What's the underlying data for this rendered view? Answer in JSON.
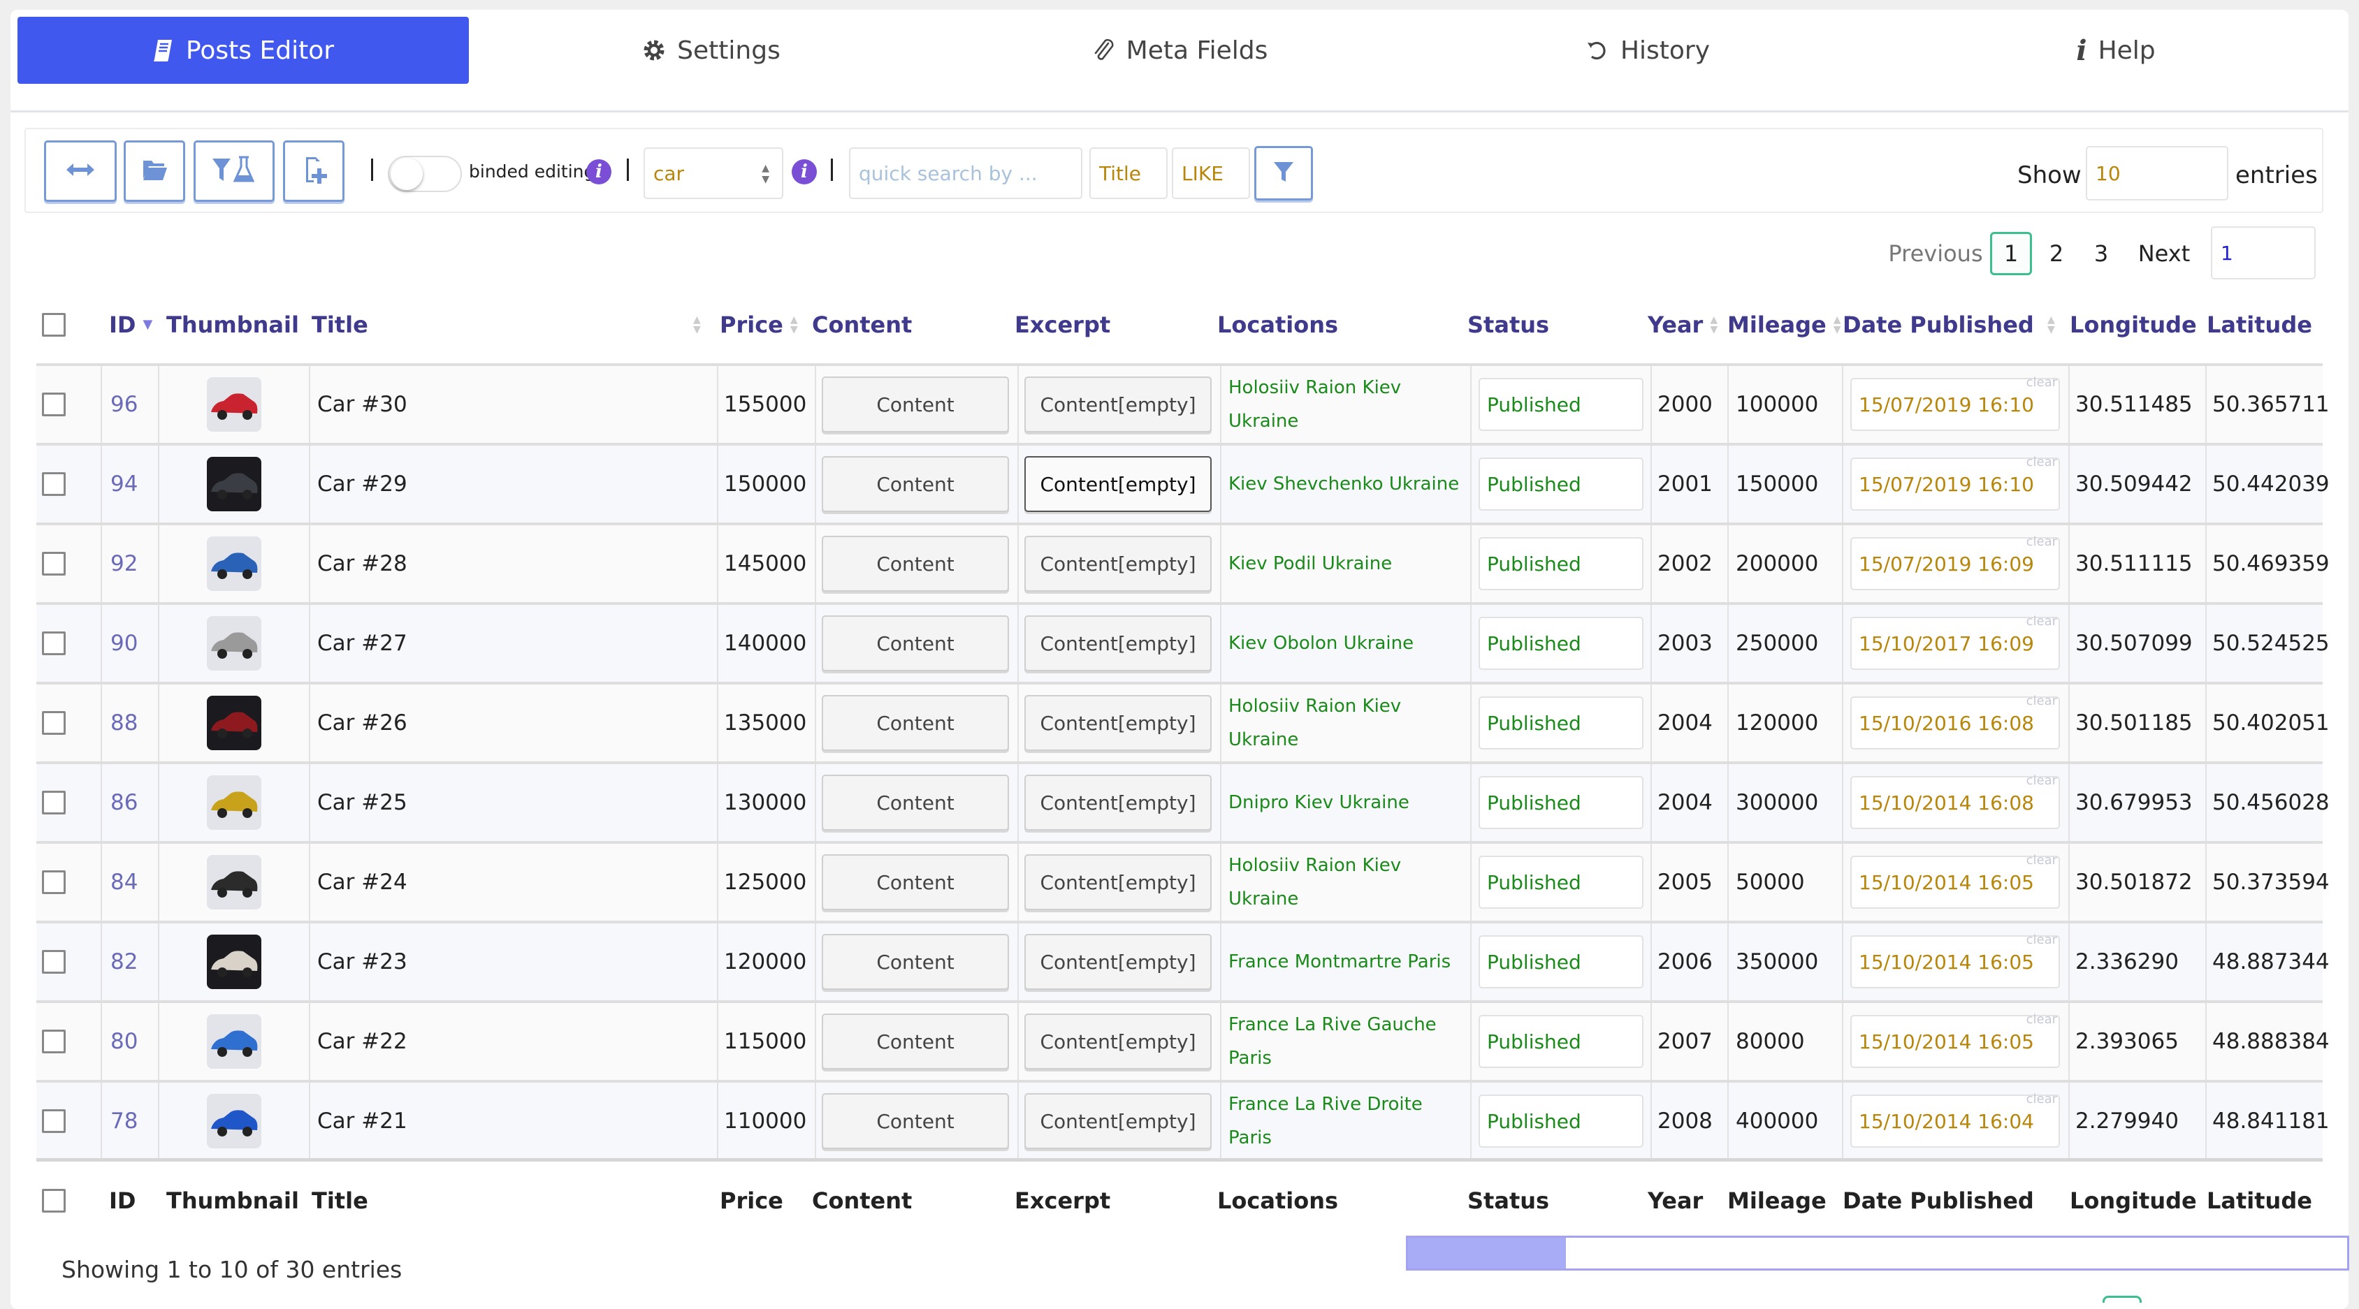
{
  "tabs": [
    {
      "label": "Posts Editor",
      "icon": "book-icon",
      "active": true
    },
    {
      "label": "Settings",
      "icon": "gear-icon",
      "active": false
    },
    {
      "label": "Meta Fields",
      "icon": "paperclip-icon",
      "active": false
    },
    {
      "label": "History",
      "icon": "history-icon",
      "active": false
    },
    {
      "label": "Help",
      "icon": "info-icon",
      "active": false
    }
  ],
  "toolbar": {
    "buttons": [
      {
        "icon": "arrows-horizontal-icon",
        "name": "fit-width-button"
      },
      {
        "icon": "folder-open-icon",
        "name": "open-folder-button"
      },
      {
        "icon": "filter-flask-icon",
        "name": "advanced-filter-button"
      },
      {
        "icon": "file-add-icon",
        "name": "add-post-button"
      }
    ],
    "binded_editing_label": "binded editing",
    "binded_editing_on": false,
    "post_type_value": "car",
    "quick_search_placeholder": "quick search by ...",
    "search_field": "Title",
    "search_operator": "LIKE",
    "info_glyph": "i"
  },
  "length": {
    "show_label": "Show",
    "value": "10",
    "entries_label": "entries"
  },
  "pagination": {
    "previous": "Previous",
    "pages": [
      "1",
      "2",
      "3"
    ],
    "current": "1",
    "next": "Next",
    "goto_value": "1"
  },
  "columns": [
    "ID",
    "Thumbnail",
    "Title",
    "Price",
    "Content",
    "Excerpt",
    "Locations",
    "Status",
    "Year",
    "Mileage",
    "Date Published",
    "Longitude",
    "Latitude"
  ],
  "clear_label": "clear",
  "rows": [
    {
      "id": "96",
      "title": "Car #30",
      "price": "155000",
      "content": "Content",
      "excerpt": "Content[empty]",
      "locations": "Holosiiv Raion  Kiev  Ukraine",
      "status": "Published",
      "year": "2000",
      "mileage": "100000",
      "date": "15/07/2019 16:10",
      "longitude": "30.511485",
      "latitude": "50.365711",
      "thumb_color": "#c9232f"
    },
    {
      "id": "94",
      "title": "Car #29",
      "price": "150000",
      "content": "Content",
      "excerpt": "Content[empty]",
      "locations": "Kiev  Shevchenko  Ukraine",
      "status": "Published",
      "year": "2001",
      "mileage": "150000",
      "date": "15/07/2019 16:10",
      "longitude": "30.509442",
      "latitude": "50.442039",
      "thumb_color": "#3a3d44"
    },
    {
      "id": "92",
      "title": "Car #28",
      "price": "145000",
      "content": "Content",
      "excerpt": "Content[empty]",
      "locations": "Kiev  Podil  Ukraine",
      "status": "Published",
      "year": "2002",
      "mileage": "200000",
      "date": "15/07/2019 16:09",
      "longitude": "30.511115",
      "latitude": "50.469359",
      "thumb_color": "#2a62b8"
    },
    {
      "id": "90",
      "title": "Car #27",
      "price": "140000",
      "content": "Content",
      "excerpt": "Content[empty]",
      "locations": "Kiev  Obolon  Ukraine",
      "status": "Published",
      "year": "2003",
      "mileage": "250000",
      "date": "15/10/2017 16:09",
      "longitude": "30.507099",
      "latitude": "50.524525",
      "thumb_color": "#9a9a9a"
    },
    {
      "id": "88",
      "title": "Car #26",
      "price": "135000",
      "content": "Content",
      "excerpt": "Content[empty]",
      "locations": "Holosiiv Raion  Kiev  Ukraine",
      "status": "Published",
      "year": "2004",
      "mileage": "120000",
      "date": "15/10/2016 16:08",
      "longitude": "30.501185",
      "latitude": "50.402051",
      "thumb_color": "#8e1a1f"
    },
    {
      "id": "86",
      "title": "Car #25",
      "price": "130000",
      "content": "Content",
      "excerpt": "Content[empty]",
      "locations": "Dnipro  Kiev  Ukraine",
      "status": "Published",
      "year": "2004",
      "mileage": "300000",
      "date": "15/10/2014 16:08",
      "longitude": "30.679953",
      "latitude": "50.456028",
      "thumb_color": "#c9a21c"
    },
    {
      "id": "84",
      "title": "Car #24",
      "price": "125000",
      "content": "Content",
      "excerpt": "Content[empty]",
      "locations": "Holosiiv Raion  Kiev  Ukraine",
      "status": "Published",
      "year": "2005",
      "mileage": "50000",
      "date": "15/10/2014 16:05",
      "longitude": "30.501872",
      "latitude": "50.373594",
      "thumb_color": "#2b2b2b"
    },
    {
      "id": "82",
      "title": "Car #23",
      "price": "120000",
      "content": "Content",
      "excerpt": "Content[empty]",
      "locations": "France  Montmartre  Paris",
      "status": "Published",
      "year": "2006",
      "mileage": "350000",
      "date": "15/10/2014 16:05",
      "longitude": "2.336290",
      "latitude": "48.887344",
      "thumb_color": "#d8d2c8"
    },
    {
      "id": "80",
      "title": "Car #22",
      "price": "115000",
      "content": "Content",
      "excerpt": "Content[empty]",
      "locations": "France  La Rive Gauche  Paris",
      "status": "Published",
      "year": "2007",
      "mileage": "80000",
      "date": "15/10/2014 16:05",
      "longitude": "2.393065",
      "latitude": "48.888384",
      "thumb_color": "#2f6fd0"
    },
    {
      "id": "78",
      "title": "Car #21",
      "price": "110000",
      "content": "Content",
      "excerpt": "Content[empty]",
      "locations": "France  La Rive Droite  Paris",
      "status": "Published",
      "year": "2008",
      "mileage": "400000",
      "date": "15/10/2014 16:04",
      "longitude": "2.279940",
      "latitude": "48.841181",
      "thumb_color": "#1f56c8"
    }
  ],
  "footer": {
    "showing": "Showing 1 to 10 of 30 entries"
  },
  "horizontal_scroll_position": 0.0
}
